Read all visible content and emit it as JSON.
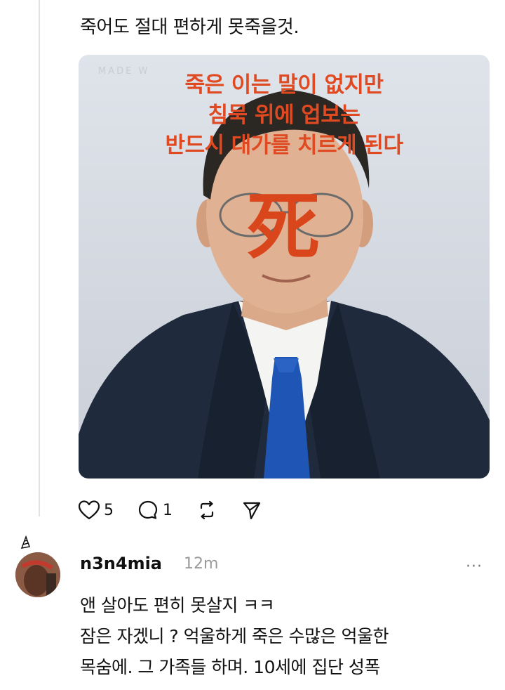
{
  "post": {
    "text": "죽어도 절대 편하게 못죽을것.",
    "image": {
      "watermark": "MADE  W",
      "overlay_lines": [
        "죽은 이는 말이 없지만",
        "침묵 위에 업보는",
        "반드시 대가를 치르게 된다"
      ],
      "hanja": "死",
      "overlay_color": "#e04a22"
    },
    "actions": {
      "like_count": "5",
      "comment_count": "1",
      "like_icon": "heart-icon",
      "comment_icon": "comment-icon",
      "repost_icon": "repost-icon",
      "share_icon": "send-icon"
    }
  },
  "reply": {
    "username": "n3n4mia",
    "timestamp": "12m",
    "more_label": "···",
    "lines": [
      "앤 살아도 편히 못살지 ㅋㅋ",
      "잠은 자겠니 ? 억울하게 죽은 수많은 억울한",
      "목숨에. 그 가족들 하며. 10세에 집단 성폭"
    ]
  }
}
